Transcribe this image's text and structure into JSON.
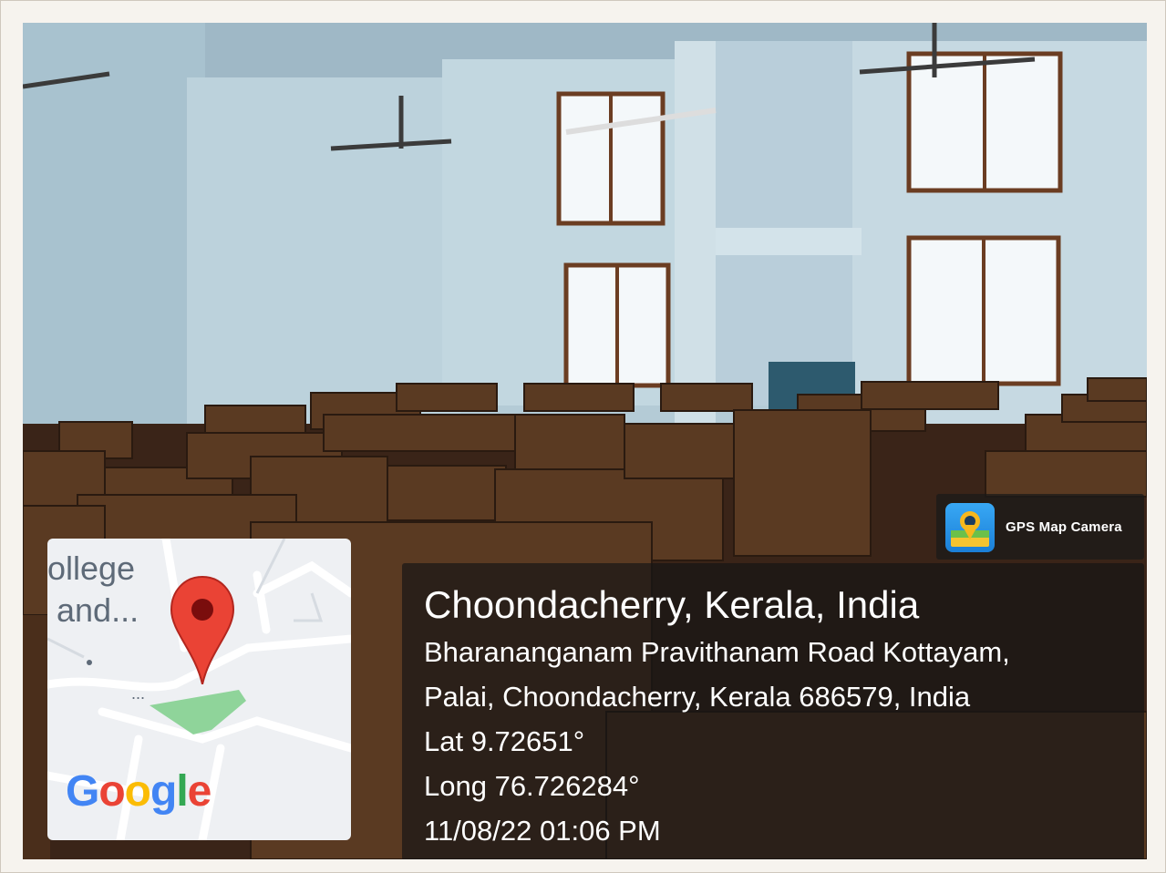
{
  "badge": {
    "app_name": "GPS Map Camera",
    "icon": "gps-map-camera-icon"
  },
  "location": {
    "title": "Choondacherry, Kerala, India",
    "address_line1": "Bharananganam Pravithanam Road Kottayam,",
    "address_line2": "Palai, Choondacherry, Kerala 686579, India",
    "latitude": "Lat 9.72651°",
    "longitude": "Long 76.726284°",
    "timestamp": "11/08/22 01:06 PM"
  },
  "map": {
    "label_line1": "ollege",
    "label_line2": "and...",
    "dots": "...",
    "provider_letters": [
      "G",
      "o",
      "o",
      "g",
      "l",
      "e"
    ],
    "provider_colors": [
      "#4285F4",
      "#EA4335",
      "#FBBC05",
      "#4285F4",
      "#34A853",
      "#EA4335"
    ],
    "pin_color": "#EA4335",
    "pin_icon": "location-pin-icon"
  }
}
